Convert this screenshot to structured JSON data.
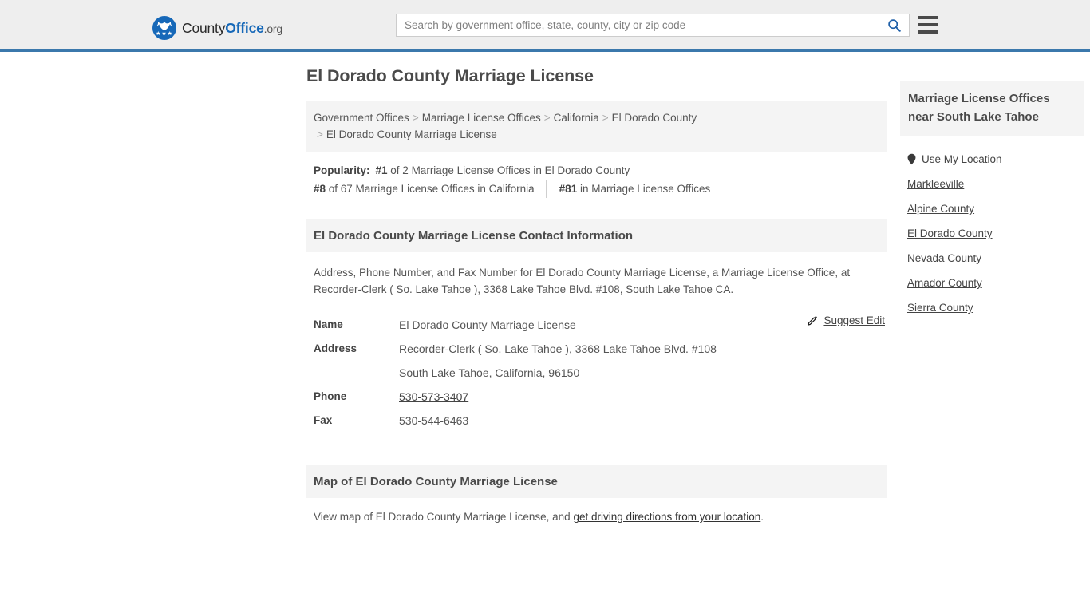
{
  "header": {
    "logo": {
      "part1": "County",
      "part2": "Office",
      "part3": ".org",
      "icon": "eagle-seal-icon"
    },
    "search": {
      "placeholder": "Search by government office, state, county, city or zip code",
      "value": "",
      "icon": "search-icon"
    },
    "menu_icon": "hamburger-menu-icon",
    "accent_color": "#3b78ac",
    "background": "#eeeeee"
  },
  "page": {
    "title": "El Dorado County Marriage License"
  },
  "breadcrumb": {
    "separator": ">",
    "items": [
      {
        "label": "Government Offices",
        "is_link": true
      },
      {
        "label": "Marriage License Offices",
        "is_link": true
      },
      {
        "label": "California",
        "is_link": true
      },
      {
        "label": "El Dorado County",
        "is_link": true
      },
      {
        "label": "El Dorado County Marriage License",
        "is_link": false
      }
    ]
  },
  "popularity": {
    "label": "Popularity:",
    "primary": {
      "rank": "#1",
      "text": " of 2 Marriage License Offices in El Dorado County"
    },
    "secondary": [
      {
        "rank": "#8",
        "text": " of 67 Marriage License Offices in California"
      },
      {
        "rank": "#81",
        "text": " in Marriage License Offices"
      }
    ]
  },
  "contact": {
    "heading": "El Dorado County Marriage License Contact Information",
    "description": "Address, Phone Number, and Fax Number for El Dorado County Marriage License, a Marriage License Office, at Recorder-Clerk ( So. Lake Tahoe ), 3368 Lake Tahoe Blvd. #108, South Lake Tahoe CA.",
    "suggest_edit": {
      "label": "Suggest Edit",
      "icon": "edit-pencil-icon"
    },
    "rows": [
      {
        "key": "Name",
        "value": "El Dorado County Marriage License",
        "is_link": false
      },
      {
        "key": "Address",
        "value": "Recorder-Clerk ( So. Lake Tahoe ), 3368 Lake Tahoe Blvd. #108",
        "is_link": false
      },
      {
        "key": "",
        "value": "South Lake Tahoe, California, 96150",
        "is_link": false
      },
      {
        "key": "Phone",
        "value": "530-573-3407",
        "is_link": true
      },
      {
        "key": "Fax",
        "value": "530-544-6463",
        "is_link": false
      }
    ]
  },
  "map": {
    "heading": "Map of El Dorado County Marriage License",
    "note_prefix": "View map of El Dorado County Marriage License, and ",
    "note_link": "get driving directions from your location",
    "note_suffix": "."
  },
  "sidebar": {
    "heading": "Marriage License Offices near South Lake Tahoe",
    "items": [
      {
        "label": "Use My Location",
        "icon": "map-pin-icon"
      },
      {
        "label": "Markleeville",
        "icon": ""
      },
      {
        "label": "Alpine County",
        "icon": ""
      },
      {
        "label": "El Dorado County",
        "icon": ""
      },
      {
        "label": "Nevada County",
        "icon": ""
      },
      {
        "label": "Amador County",
        "icon": ""
      },
      {
        "label": "Sierra County",
        "icon": ""
      }
    ]
  }
}
